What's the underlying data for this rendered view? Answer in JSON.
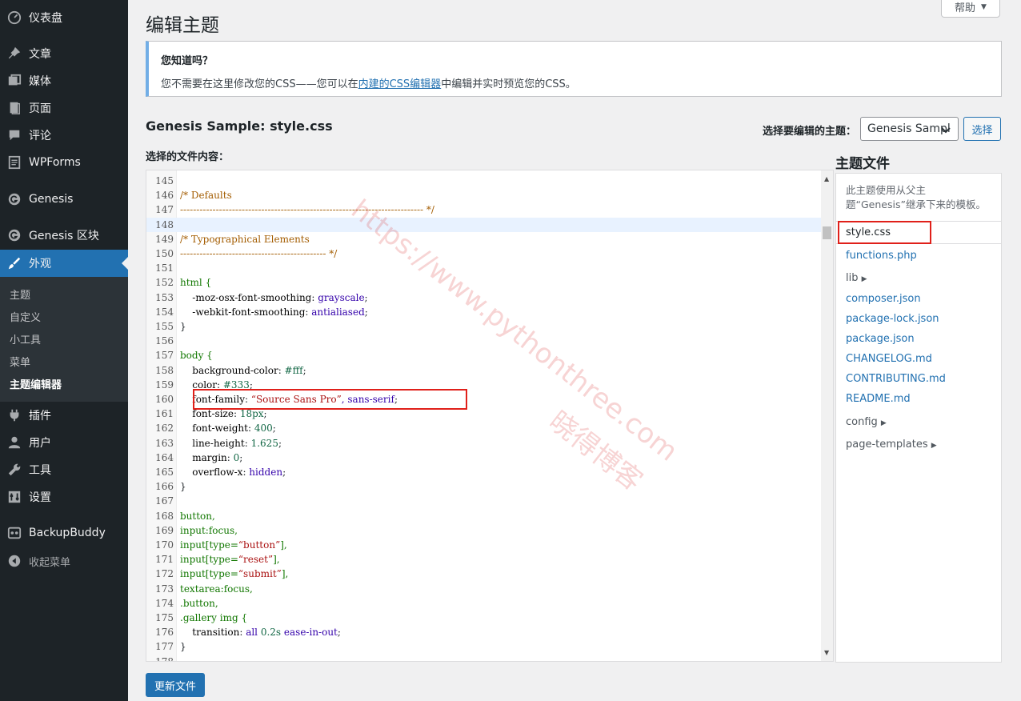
{
  "sidebar": {
    "items": [
      {
        "label": "仪表盘",
        "icon": "dashboard-icon"
      },
      {
        "label": "文章",
        "icon": "pin-icon"
      },
      {
        "label": "媒体",
        "icon": "media-icon"
      },
      {
        "label": "页面",
        "icon": "page-icon"
      },
      {
        "label": "评论",
        "icon": "comment-icon"
      },
      {
        "label": "WPForms",
        "icon": "forms-icon"
      },
      {
        "label": "Genesis",
        "icon": "genesis-icon"
      },
      {
        "label": "Genesis 区块",
        "icon": "genesis-icon"
      },
      {
        "label": "外观",
        "icon": "brush-icon"
      },
      {
        "label": "插件",
        "icon": "plugin-icon"
      },
      {
        "label": "用户",
        "icon": "user-icon"
      },
      {
        "label": "工具",
        "icon": "wrench-icon"
      },
      {
        "label": "设置",
        "icon": "settings-icon"
      },
      {
        "label": "BackupBuddy",
        "icon": "backup-icon"
      },
      {
        "label": "收起菜单",
        "icon": "collapse-icon"
      }
    ],
    "submenu": [
      "主题",
      "自定义",
      "小工具",
      "菜单",
      "主题编辑器"
    ]
  },
  "header": {
    "title": "编辑主题",
    "help_label": "帮助"
  },
  "notice": {
    "title": "您知道吗？",
    "text_before": "您不需要在这里修改您的CSS——您可以在",
    "link": "内建的CSS编辑器",
    "text_after": "中编辑并实时预览您的CSS。"
  },
  "editor": {
    "file_heading": "Genesis Sample: style.css",
    "content_label": "选择的文件内容：",
    "theme_select_label": "选择要编辑的主题：",
    "theme_select_value": "Genesis Sampl",
    "select_button": "选择",
    "update_button": "更新文件",
    "lines": [
      {
        "n": "145",
        "code": ""
      },
      {
        "n": "146",
        "code": "/* Defaults"
      },
      {
        "n": "147",
        "code": "--------------------------------------------------------------------------- */"
      },
      {
        "n": "148",
        "code": ""
      },
      {
        "n": "149",
        "code": "/* Typographical Elements"
      },
      {
        "n": "150",
        "code": "--------------------------------------------- */"
      },
      {
        "n": "151",
        "code": ""
      },
      {
        "n": "152",
        "code": "html {"
      },
      {
        "n": "153",
        "code": "    -moz-osx-font-smoothing: grayscale;"
      },
      {
        "n": "154",
        "code": "    -webkit-font-smoothing: antialiased;"
      },
      {
        "n": "155",
        "code": "}"
      },
      {
        "n": "156",
        "code": ""
      },
      {
        "n": "157",
        "code": "body {"
      },
      {
        "n": "158",
        "code": "    background-color: #fff;"
      },
      {
        "n": "159",
        "code": "    color: #333;"
      },
      {
        "n": "160",
        "code": "    font-family: “Source Sans Pro”, sans-serif;"
      },
      {
        "n": "161",
        "code": "    font-size: 18px;"
      },
      {
        "n": "162",
        "code": "    font-weight: 400;"
      },
      {
        "n": "163",
        "code": "    line-height: 1.625;"
      },
      {
        "n": "164",
        "code": "    margin: 0;"
      },
      {
        "n": "165",
        "code": "    overflow-x: hidden;"
      },
      {
        "n": "166",
        "code": "}"
      },
      {
        "n": "167",
        "code": ""
      },
      {
        "n": "168",
        "code": "button,"
      },
      {
        "n": "169",
        "code": "input:focus,"
      },
      {
        "n": "170",
        "code": "input[type=“button”],"
      },
      {
        "n": "171",
        "code": "input[type=“reset”],"
      },
      {
        "n": "172",
        "code": "input[type=“submit”],"
      },
      {
        "n": "173",
        "code": "textarea:focus,"
      },
      {
        "n": "174",
        "code": ".button,"
      },
      {
        "n": "175",
        "code": ".gallery img {"
      },
      {
        "n": "176",
        "code": "    transition: all 0.2s ease-in-out;"
      },
      {
        "n": "177",
        "code": "}"
      },
      {
        "n": "178",
        "code": ""
      }
    ]
  },
  "files": {
    "heading": "主题文件",
    "description": "此主题使用从父主题“Genesis”继承下来的模板。",
    "items": [
      {
        "label": "style.css",
        "type": "file"
      },
      {
        "label": "functions.php",
        "type": "file"
      },
      {
        "label": "lib",
        "type": "dir"
      },
      {
        "label": "composer.json",
        "type": "file"
      },
      {
        "label": "package-lock.json",
        "type": "file"
      },
      {
        "label": "package.json",
        "type": "file"
      },
      {
        "label": "CHANGELOG.md",
        "type": "file"
      },
      {
        "label": "CONTRIBUTING.md",
        "type": "file"
      },
      {
        "label": "README.md",
        "type": "file"
      },
      {
        "label": "config",
        "type": "dir"
      },
      {
        "label": "page-templates",
        "type": "dir"
      }
    ]
  },
  "watermark": {
    "url": "https://www.pythonthree.com",
    "site": "晓得博客"
  },
  "colors": {
    "sidebar_bg": "#1d2327",
    "accent": "#2271b1",
    "highlight_box": "#e0201a"
  }
}
